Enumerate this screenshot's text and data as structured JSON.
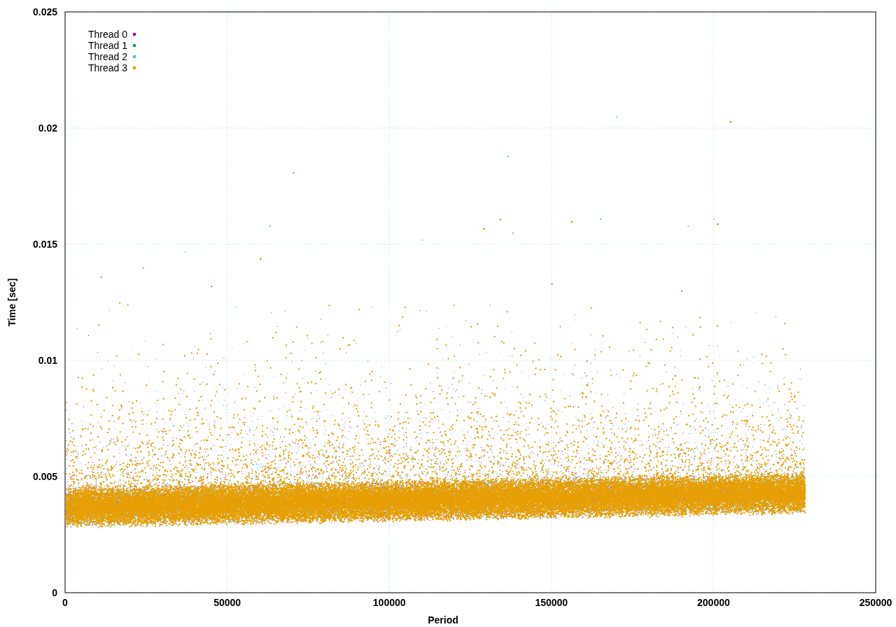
{
  "chart_data": {
    "type": "scatter",
    "xlabel": "Period",
    "ylabel": "Time [sec]",
    "xlim": [
      0,
      250000
    ],
    "ylim": [
      0,
      0.025
    ],
    "grid": true,
    "legend": true,
    "xticks": [
      0,
      50000,
      100000,
      150000,
      200000,
      250000
    ],
    "yticks": [
      {
        "value": 0,
        "label": "0"
      },
      {
        "value": 0.005,
        "label": "0.005"
      },
      {
        "value": 0.01,
        "label": "0.01"
      },
      {
        "value": 0.015,
        "label": "0.015"
      },
      {
        "value": 0.02,
        "label": "0.02"
      },
      {
        "value": 0.025,
        "label": "0.025"
      }
    ],
    "series": [
      {
        "name": "Thread 0",
        "color": "#9400d3",
        "x": [
          70300,
          11000,
          45000,
          150000,
          190000
        ],
        "values": [
          0.0181,
          0.0136,
          0.0132,
          0.0133,
          0.013
        ]
      },
      {
        "name": "Thread 1",
        "color": "#009e73",
        "x": [
          136500,
          63000,
          165000,
          138000,
          24000
        ],
        "values": [
          0.0188,
          0.0158,
          0.0161,
          0.0155,
          0.014
        ]
      },
      {
        "name": "Thread 2",
        "color": "#56b4e9",
        "x": [
          170000,
          200000,
          192000,
          110000,
          37000
        ],
        "values": [
          0.0205,
          0.0161,
          0.0158,
          0.0152,
          0.0147
        ]
      },
      {
        "name": "Thread 3",
        "color": "#e69f00",
        "x": [
          205000,
          134000,
          156000,
          129000,
          201000,
          60000
        ],
        "values": [
          0.0203,
          0.0161,
          0.016,
          0.0157,
          0.0159,
          0.0144
        ]
      }
    ]
  }
}
